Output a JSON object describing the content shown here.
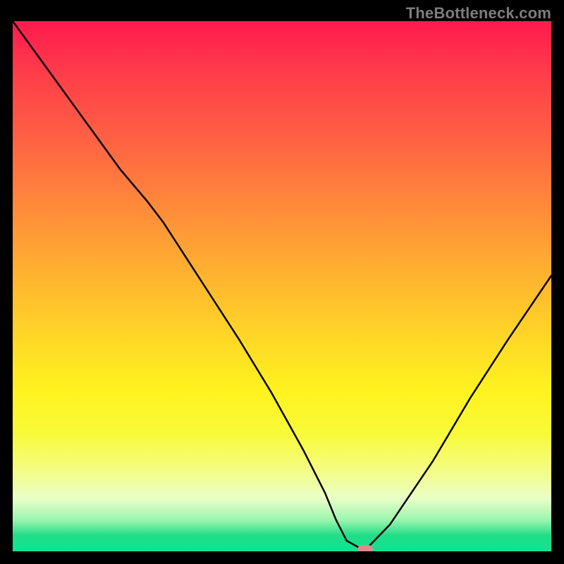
{
  "watermark": "TheBottleneck.com",
  "chart_data": {
    "type": "line",
    "title": "",
    "xlabel": "",
    "ylabel": "",
    "x": [
      0.0,
      0.05,
      0.1,
      0.15,
      0.2,
      0.25,
      0.28,
      0.35,
      0.42,
      0.48,
      0.54,
      0.58,
      0.6,
      0.62,
      0.65,
      0.655,
      0.7,
      0.78,
      0.85,
      0.92,
      1.0
    ],
    "values": [
      1.0,
      0.93,
      0.86,
      0.79,
      0.72,
      0.66,
      0.62,
      0.51,
      0.4,
      0.3,
      0.19,
      0.11,
      0.06,
      0.02,
      0.003,
      0.003,
      0.05,
      0.17,
      0.29,
      0.4,
      0.52
    ],
    "xlim": [
      0,
      1
    ],
    "ylim": [
      0,
      1
    ],
    "marker": {
      "x": 0.655,
      "y": 0.003
    },
    "gradient_stops": [
      {
        "pos": 0.0,
        "color": "#ff1a4d"
      },
      {
        "pos": 0.5,
        "color": "#ffd826"
      },
      {
        "pos": 0.8,
        "color": "#f4fd88"
      },
      {
        "pos": 0.97,
        "color": "#22dd88"
      },
      {
        "pos": 1.0,
        "color": "#13e18e"
      }
    ]
  }
}
